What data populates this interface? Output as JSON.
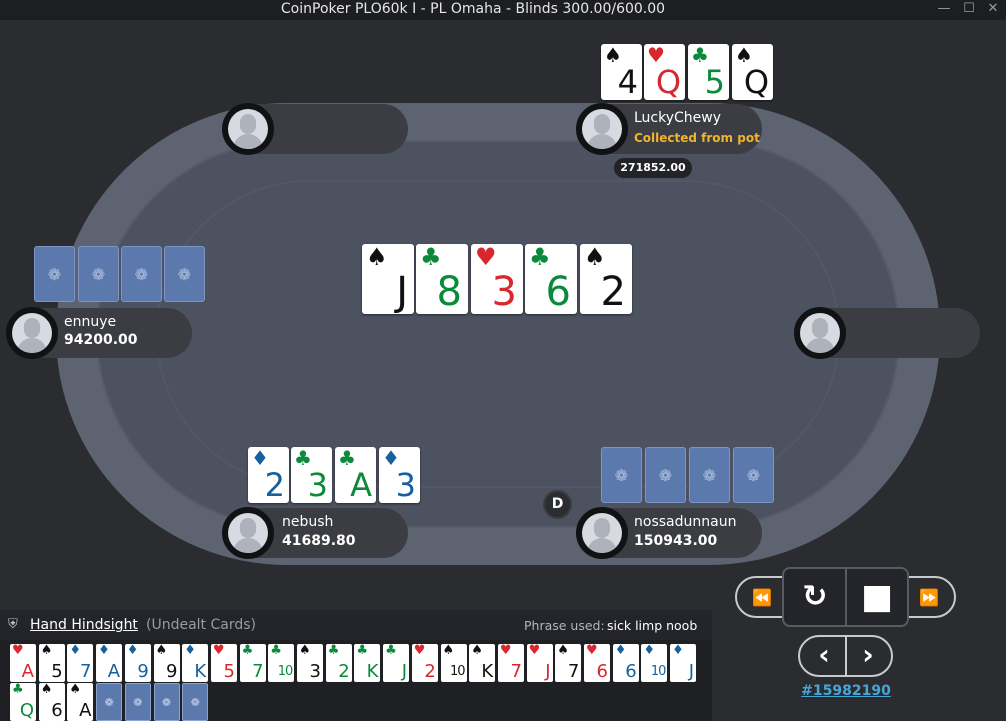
{
  "window": {
    "title": "CoinPoker PLO60k I - PL Omaha - Blinds 300.00/600.00",
    "minimize": "—",
    "maximize": "☐",
    "close": "✕"
  },
  "board": [
    {
      "rank": "J",
      "suit": "♠",
      "color": "s"
    },
    {
      "rank": "8",
      "suit": "♣",
      "color": "c"
    },
    {
      "rank": "3",
      "suit": "♥",
      "color": "h"
    },
    {
      "rank": "6",
      "suit": "♣",
      "color": "c"
    },
    {
      "rank": "2",
      "suit": "♠",
      "color": "s"
    }
  ],
  "players": {
    "luckychewy": {
      "name": "LuckyChewy",
      "status": "Collected from pot",
      "stack": "271852.00",
      "cards": [
        {
          "rank": "4",
          "suit": "♠",
          "color": "s"
        },
        {
          "rank": "Q",
          "suit": "♥",
          "color": "h"
        },
        {
          "rank": "5",
          "suit": "♣",
          "color": "c"
        },
        {
          "rank": "Q",
          "suit": "♠",
          "color": "s"
        }
      ]
    },
    "ennuye": {
      "name": "ennuye",
      "stack": "94200.00"
    },
    "nebush": {
      "name": "nebush",
      "stack": "41689.80",
      "cards": [
        {
          "rank": "2",
          "suit": "♦",
          "color": "d"
        },
        {
          "rank": "3",
          "suit": "♣",
          "color": "c"
        },
        {
          "rank": "A",
          "suit": "♣",
          "color": "c"
        },
        {
          "rank": "3",
          "suit": "♦",
          "color": "d"
        }
      ]
    },
    "nossadunnaun": {
      "name": "nossadunnaun",
      "stack": "150943.00"
    }
  },
  "dealer_button": "D",
  "card_back_icon": "coin-logo-icon",
  "controls": {
    "rewind": "⏪",
    "replay": "↻",
    "stop": "■",
    "forward": "⏩",
    "prev": "‹",
    "next": "›",
    "hand_id": "#15982190"
  },
  "hindsight": {
    "title": "Hand Hindsight",
    "subtitle": "(Undealt Cards)",
    "phrase_label": "Phrase used:",
    "phrase": "sick limp noob",
    "cards": [
      {
        "rank": "A",
        "suit": "♥",
        "color": "h"
      },
      {
        "rank": "5",
        "suit": "♠",
        "color": "s"
      },
      {
        "rank": "7",
        "suit": "♦",
        "color": "d"
      },
      {
        "rank": "A",
        "suit": "♦",
        "color": "d"
      },
      {
        "rank": "9",
        "suit": "♦",
        "color": "d"
      },
      {
        "rank": "9",
        "suit": "♠",
        "color": "s"
      },
      {
        "rank": "K",
        "suit": "♦",
        "color": "d"
      },
      {
        "rank": "5",
        "suit": "♥",
        "color": "h"
      },
      {
        "rank": "7",
        "suit": "♣",
        "color": "c"
      },
      {
        "rank": "10",
        "suit": "♣",
        "color": "c"
      },
      {
        "rank": "3",
        "suit": "♠",
        "color": "s"
      },
      {
        "rank": "2",
        "suit": "♣",
        "color": "c"
      },
      {
        "rank": "K",
        "suit": "♣",
        "color": "c"
      },
      {
        "rank": "J",
        "suit": "♣",
        "color": "c"
      },
      {
        "rank": "2",
        "suit": "♥",
        "color": "h"
      },
      {
        "rank": "10",
        "suit": "♠",
        "color": "s"
      },
      {
        "rank": "K",
        "suit": "♠",
        "color": "s"
      },
      {
        "rank": "7",
        "suit": "♥",
        "color": "h"
      },
      {
        "rank": "J",
        "suit": "♥",
        "color": "h"
      },
      {
        "rank": "7",
        "suit": "♠",
        "color": "s"
      },
      {
        "rank": "6",
        "suit": "♥",
        "color": "h"
      },
      {
        "rank": "6",
        "suit": "♦",
        "color": "d"
      },
      {
        "rank": "10",
        "suit": "♦",
        "color": "d"
      },
      {
        "rank": "J",
        "suit": "♦",
        "color": "d"
      },
      {
        "rank": "Q",
        "suit": "♣",
        "color": "c"
      },
      {
        "rank": "6",
        "suit": "♠",
        "color": "s"
      },
      {
        "rank": "A",
        "suit": "♠",
        "color": "s"
      }
    ],
    "hidden_count": 4
  }
}
